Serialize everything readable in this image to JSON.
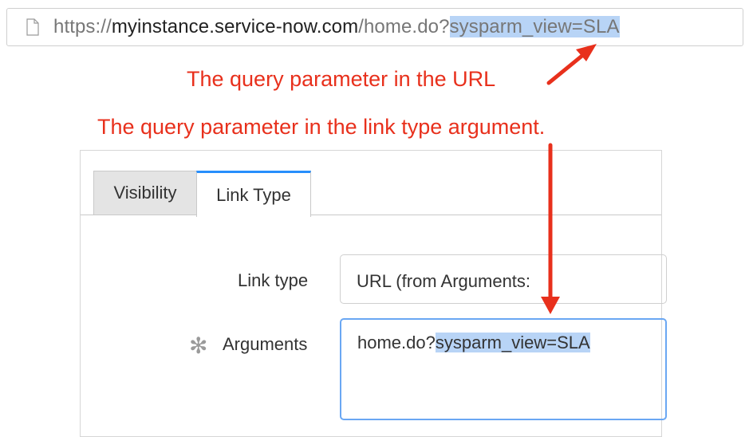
{
  "browser": {
    "url_scheme": "https://",
    "url_host": "myinstance.service-now.com",
    "url_path": "/home.do?",
    "url_query": "sysparm_view=SLA"
  },
  "annotations": {
    "url_note": "The query parameter in the URL",
    "link_note": "The query parameter in the link type argument.",
    "color": "#e8301c"
  },
  "tabs": [
    {
      "label": "Visibility",
      "active": false
    },
    {
      "label": "Link Type",
      "active": true
    }
  ],
  "form": {
    "link_type_label": "Link type",
    "link_type_value": "URL (from Arguments:",
    "arguments_label": "Arguments",
    "arguments_required_marker": "✻",
    "arguments_prefix": "home.do?",
    "arguments_query": "sysparm_view=SLA"
  },
  "colors": {
    "active_tab_accent": "#278efc",
    "highlight": "#b8d4f6",
    "focus_border": "#6aa7f3"
  },
  "icons": {
    "page": "page-icon"
  }
}
